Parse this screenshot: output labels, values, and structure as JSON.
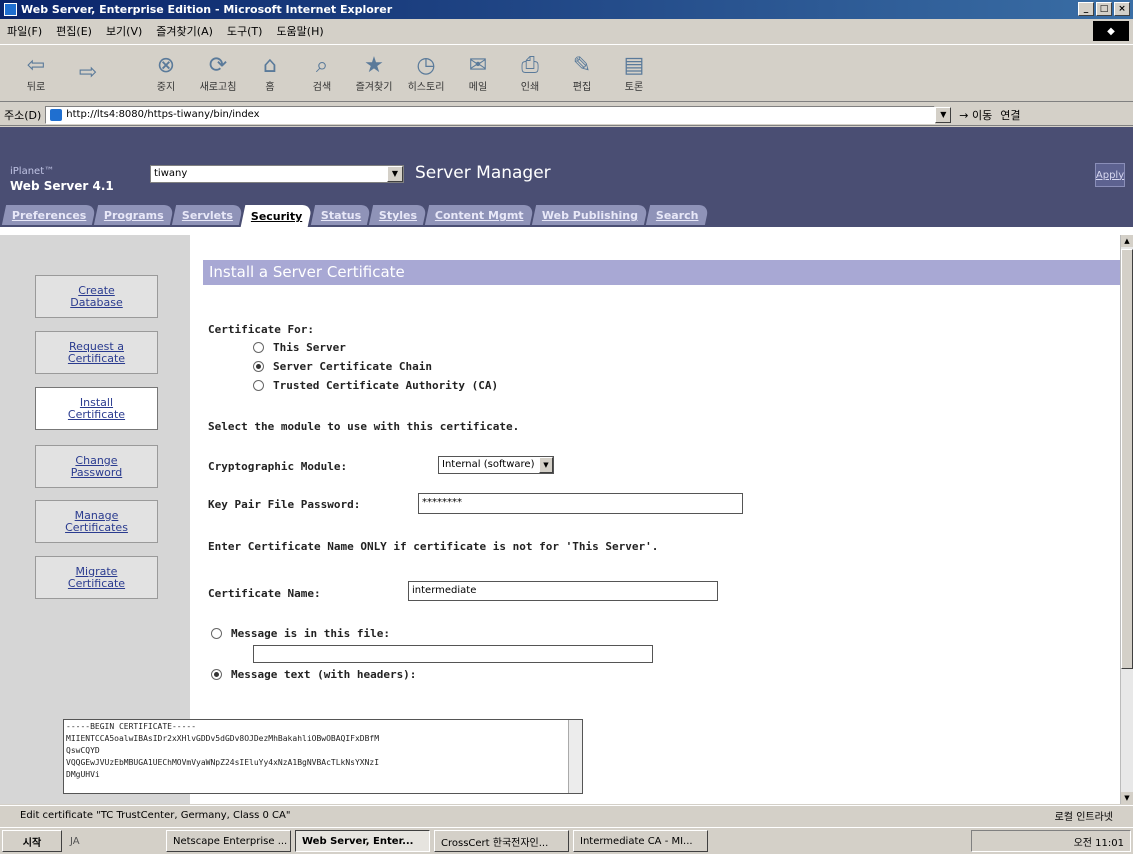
{
  "window": {
    "title": "Web Server, Enterprise Edition - Microsoft Internet Explorer"
  },
  "menu": [
    "파일(F)",
    "편집(E)",
    "보기(V)",
    "즐겨찾기(A)",
    "도구(T)",
    "도움말(H)"
  ],
  "toolbar": [
    "뒤로",
    "",
    "",
    "중지",
    "새로고침",
    "홈",
    "검색",
    "즐겨찾기",
    "히스토리",
    "메일",
    "인쇄",
    "편집",
    "토론"
  ],
  "address": {
    "label": "주소(D)",
    "url": "http://lts4:8080/https-tiwany/bin/index",
    "go": "이동",
    "links": "연결"
  },
  "header": {
    "product_line1": "iPlanet™",
    "product_line2": "Web Server 4.1",
    "server": "tiwany",
    "title": "Server Manager",
    "apply": "Apply"
  },
  "tabs": [
    "Preferences",
    "Programs",
    "Servlets",
    "Security",
    "Status",
    "Styles",
    "Content Mgmt",
    "Web Publishing",
    "Search"
  ],
  "active_tab": "Security",
  "sidebar": [
    {
      "label1": "Create",
      "label2": "Database"
    },
    {
      "label1": "Request a",
      "label2": "Certificate"
    },
    {
      "label1": "Install",
      "label2": "Certificate"
    },
    {
      "label1": "Change",
      "label2": "Password"
    },
    {
      "label1": "Manage",
      "label2": "Certificates"
    },
    {
      "label1": "Migrate",
      "label2": "Certificate"
    }
  ],
  "page": {
    "title": "Install a Server Certificate",
    "cert_for_label": "Certificate For:",
    "radio_this_server": "This Server",
    "radio_chain": "Server Certificate Chain",
    "radio_ca": "Trusted Certificate Authority (CA)",
    "select_module_text": "Select the module to use with this certificate.",
    "crypto_label": "Cryptographic Module:",
    "crypto_value": "Internal (software)",
    "password_label": "Key Pair File Password:",
    "password_value": "********",
    "enter_name_text": "Enter Certificate Name ONLY if certificate is not for 'This Server'.",
    "cert_name_label": "Certificate Name:",
    "cert_name_value": "intermediate",
    "msg_file_label": "Message is in this file:",
    "msg_file_value": "",
    "msg_text_label": "Message text (with headers):",
    "cert_text": [
      "-----BEGIN CERTIFICATE-----",
      "MIIENTCCA5oalwIBAsIDr2xXHlvGDDv5dGDv8OJDezMhBakahliOBwOBAQIFxDBfM",
      "QswCQYD",
      "VQQGEwJVUzEbMBUGA1UEChMOVmVyaWNpZ24sIEluYy4xNzA1BgNVBAcTLkNsYXNzI",
      "DMgUHVi"
    ]
  },
  "statusbar": {
    "text": "Edit certificate \"TC TrustCenter, Germany, Class 0 CA\"",
    "zone": "로컬 인트라넷"
  },
  "taskbar": {
    "start": "시작",
    "quicklaunch": "JA",
    "tasks": [
      "Netscape Enterprise ...",
      "Web Server, Enter...",
      "CrossCert 한국전자인...",
      "Intermediate CA - MI..."
    ],
    "clock": "오전 11:01"
  }
}
